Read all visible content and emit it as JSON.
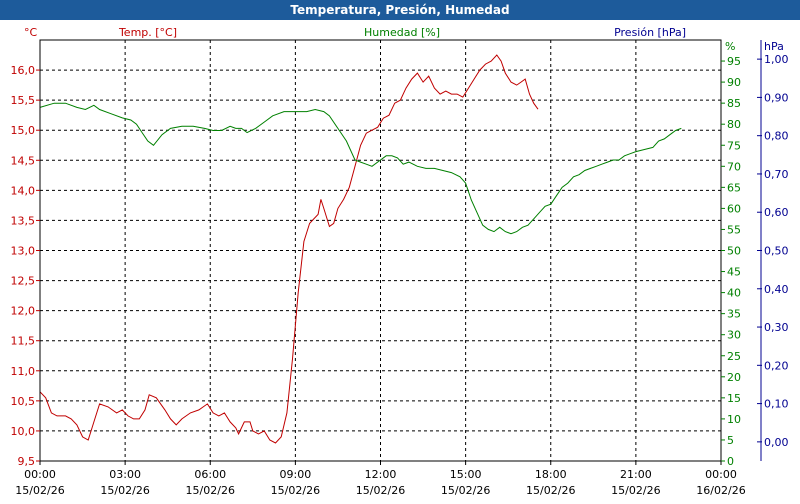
{
  "window": {
    "title": "Temperatura, Presión, Humedad"
  },
  "colors": {
    "titlebar": "#1d5b9b",
    "temperature": "#c00000",
    "humidity": "#008000",
    "pressure": "#000090",
    "grid": "#000000"
  },
  "chart_data": {
    "type": "line",
    "title": "Temperatura, Presión, Humedad",
    "grid": true,
    "x_ticks": [
      {
        "time": "00:00",
        "date": "15/02/26"
      },
      {
        "time": "03:00",
        "date": "15/02/26"
      },
      {
        "time": "06:00",
        "date": "15/02/26"
      },
      {
        "time": "09:00",
        "date": "15/02/26"
      },
      {
        "time": "12:00",
        "date": "15/02/26"
      },
      {
        "time": "15:00",
        "date": "15/02/26"
      },
      {
        "time": "18:00",
        "date": "15/02/26"
      },
      {
        "time": "21:00",
        "date": "15/02/26"
      },
      {
        "time": "00:00",
        "date": "16/02/26"
      }
    ],
    "xlim": [
      0,
      24
    ],
    "axes": {
      "temperature": {
        "unit": "°C",
        "label": "Temp. [°C]",
        "ylim": [
          9.5,
          16.5
        ],
        "ticks": [
          "9,5",
          "10,0",
          "10,5",
          "11,0",
          "11,5",
          "12,0",
          "12,5",
          "13,0",
          "13,5",
          "14,0",
          "14,5",
          "15,0",
          "15,5",
          "16,0"
        ]
      },
      "humidity": {
        "unit": "%",
        "label": "Humedad [%]",
        "ylim": [
          0,
          100
        ],
        "ticks": [
          "0",
          "5",
          "10",
          "15",
          "20",
          "25",
          "30",
          "35",
          "40",
          "45",
          "50",
          "55",
          "60",
          "65",
          "70",
          "75",
          "80",
          "85",
          "90",
          "95"
        ]
      },
      "pressure": {
        "unit": "hPa",
        "label": "Presión [hPa]",
        "ylim": [
          -0.05,
          1.05
        ],
        "ticks": [
          "0,00",
          "0,10",
          "0,20",
          "0,30",
          "0,40",
          "0,50",
          "0,60",
          "0,70",
          "0,80",
          "0,90",
          "1,00"
        ]
      }
    },
    "series": [
      {
        "name": "Temp. [°C]",
        "axis": "temperature",
        "points": [
          [
            0.0,
            10.65
          ],
          [
            0.2,
            10.55
          ],
          [
            0.4,
            10.3
          ],
          [
            0.6,
            10.25
          ],
          [
            0.9,
            10.25
          ],
          [
            1.1,
            10.2
          ],
          [
            1.3,
            10.1
          ],
          [
            1.5,
            9.9
          ],
          [
            1.7,
            9.85
          ],
          [
            1.9,
            10.15
          ],
          [
            2.1,
            10.45
          ],
          [
            2.4,
            10.4
          ],
          [
            2.7,
            10.3
          ],
          [
            2.9,
            10.35
          ],
          [
            3.1,
            10.25
          ],
          [
            3.3,
            10.2
          ],
          [
            3.5,
            10.2
          ],
          [
            3.7,
            10.35
          ],
          [
            3.85,
            10.6
          ],
          [
            4.1,
            10.55
          ],
          [
            4.4,
            10.35
          ],
          [
            4.6,
            10.2
          ],
          [
            4.8,
            10.1
          ],
          [
            5.0,
            10.2
          ],
          [
            5.3,
            10.3
          ],
          [
            5.6,
            10.35
          ],
          [
            5.9,
            10.45
          ],
          [
            6.1,
            10.3
          ],
          [
            6.3,
            10.25
          ],
          [
            6.5,
            10.3
          ],
          [
            6.7,
            10.15
          ],
          [
            6.9,
            10.05
          ],
          [
            7.0,
            9.95
          ],
          [
            7.2,
            10.15
          ],
          [
            7.4,
            10.15
          ],
          [
            7.5,
            10.0
          ],
          [
            7.7,
            9.95
          ],
          [
            7.9,
            10.0
          ],
          [
            8.1,
            9.85
          ],
          [
            8.3,
            9.8
          ],
          [
            8.5,
            9.9
          ],
          [
            8.7,
            10.3
          ],
          [
            8.9,
            11.2
          ],
          [
            9.1,
            12.3
          ],
          [
            9.3,
            13.15
          ],
          [
            9.5,
            13.45
          ],
          [
            9.6,
            13.5
          ],
          [
            9.8,
            13.6
          ],
          [
            9.9,
            13.85
          ],
          [
            10.0,
            13.7
          ],
          [
            10.1,
            13.55
          ],
          [
            10.2,
            13.4
          ],
          [
            10.35,
            13.45
          ],
          [
            10.5,
            13.7
          ],
          [
            10.7,
            13.85
          ],
          [
            10.9,
            14.05
          ],
          [
            11.1,
            14.4
          ],
          [
            11.3,
            14.75
          ],
          [
            11.5,
            14.95
          ],
          [
            11.7,
            15.0
          ],
          [
            11.9,
            15.05
          ],
          [
            12.1,
            15.2
          ],
          [
            12.3,
            15.25
          ],
          [
            12.5,
            15.45
          ],
          [
            12.7,
            15.5
          ],
          [
            12.9,
            15.7
          ],
          [
            13.1,
            15.85
          ],
          [
            13.3,
            15.95
          ],
          [
            13.5,
            15.8
          ],
          [
            13.7,
            15.9
          ],
          [
            13.9,
            15.7
          ],
          [
            14.1,
            15.6
          ],
          [
            14.3,
            15.65
          ],
          [
            14.5,
            15.6
          ],
          [
            14.7,
            15.6
          ],
          [
            14.9,
            15.55
          ],
          [
            15.1,
            15.7
          ],
          [
            15.3,
            15.85
          ],
          [
            15.5,
            16.0
          ],
          [
            15.7,
            16.1
          ],
          [
            15.9,
            16.15
          ],
          [
            16.1,
            16.25
          ],
          [
            16.25,
            16.15
          ],
          [
            16.4,
            15.95
          ],
          [
            16.6,
            15.8
          ],
          [
            16.8,
            15.75
          ],
          [
            16.95,
            15.8
          ],
          [
            17.1,
            15.85
          ],
          [
            17.25,
            15.6
          ],
          [
            17.4,
            15.45
          ],
          [
            17.55,
            15.35
          ]
        ]
      },
      {
        "name": "Humedad [%]",
        "axis": "humidity",
        "points": [
          [
            0.0,
            84
          ],
          [
            0.5,
            85
          ],
          [
            0.9,
            85
          ],
          [
            1.3,
            84
          ],
          [
            1.6,
            83.5
          ],
          [
            1.9,
            84.5
          ],
          [
            2.1,
            83.5
          ],
          [
            2.5,
            82.5
          ],
          [
            2.9,
            81.5
          ],
          [
            3.2,
            81
          ],
          [
            3.4,
            80
          ],
          [
            3.6,
            78
          ],
          [
            3.8,
            76
          ],
          [
            4.0,
            75
          ],
          [
            4.3,
            77.5
          ],
          [
            4.6,
            79
          ],
          [
            5.0,
            79.5
          ],
          [
            5.4,
            79.5
          ],
          [
            5.8,
            79
          ],
          [
            6.1,
            78.5
          ],
          [
            6.4,
            78.5
          ],
          [
            6.7,
            79.5
          ],
          [
            6.9,
            79
          ],
          [
            7.1,
            79
          ],
          [
            7.3,
            78
          ],
          [
            7.6,
            79
          ],
          [
            7.9,
            80.5
          ],
          [
            8.2,
            82
          ],
          [
            8.6,
            83
          ],
          [
            9.0,
            83
          ],
          [
            9.4,
            83
          ],
          [
            9.7,
            83.5
          ],
          [
            10.0,
            83
          ],
          [
            10.2,
            82
          ],
          [
            10.5,
            79
          ],
          [
            10.8,
            76
          ],
          [
            11.1,
            71.5
          ],
          [
            11.3,
            71
          ],
          [
            11.5,
            70.5
          ],
          [
            11.7,
            70
          ],
          [
            12.0,
            71.5
          ],
          [
            12.2,
            72.5
          ],
          [
            12.4,
            72.5
          ],
          [
            12.6,
            72
          ],
          [
            12.8,
            70.5
          ],
          [
            13.0,
            71
          ],
          [
            13.3,
            70
          ],
          [
            13.6,
            69.5
          ],
          [
            13.9,
            69.5
          ],
          [
            14.2,
            69
          ],
          [
            14.5,
            68.5
          ],
          [
            14.8,
            67.5
          ],
          [
            15.0,
            66
          ],
          [
            15.2,
            62
          ],
          [
            15.4,
            59
          ],
          [
            15.6,
            56
          ],
          [
            15.8,
            55
          ],
          [
            16.0,
            54.5
          ],
          [
            16.2,
            55.5
          ],
          [
            16.4,
            54.5
          ],
          [
            16.6,
            54
          ],
          [
            16.8,
            54.5
          ],
          [
            17.0,
            55.5
          ],
          [
            17.2,
            56
          ],
          [
            17.4,
            57.5
          ],
          [
            17.6,
            59
          ],
          [
            17.8,
            60.5
          ],
          [
            18.0,
            61
          ],
          [
            18.2,
            63
          ],
          [
            18.4,
            65
          ],
          [
            18.6,
            66
          ],
          [
            18.8,
            67.5
          ],
          [
            19.0,
            68
          ],
          [
            19.2,
            69
          ],
          [
            19.4,
            69.5
          ],
          [
            19.6,
            70
          ],
          [
            19.8,
            70.5
          ],
          [
            20.0,
            71
          ],
          [
            20.2,
            71.5
          ],
          [
            20.4,
            71.5
          ],
          [
            20.6,
            72.5
          ],
          [
            20.8,
            73
          ],
          [
            21.0,
            73.5
          ],
          [
            21.3,
            74
          ],
          [
            21.6,
            74.5
          ],
          [
            21.8,
            76
          ],
          [
            22.0,
            76.5
          ],
          [
            22.2,
            77.5
          ],
          [
            22.4,
            78.5
          ],
          [
            22.6,
            79
          ]
        ]
      }
    ]
  }
}
